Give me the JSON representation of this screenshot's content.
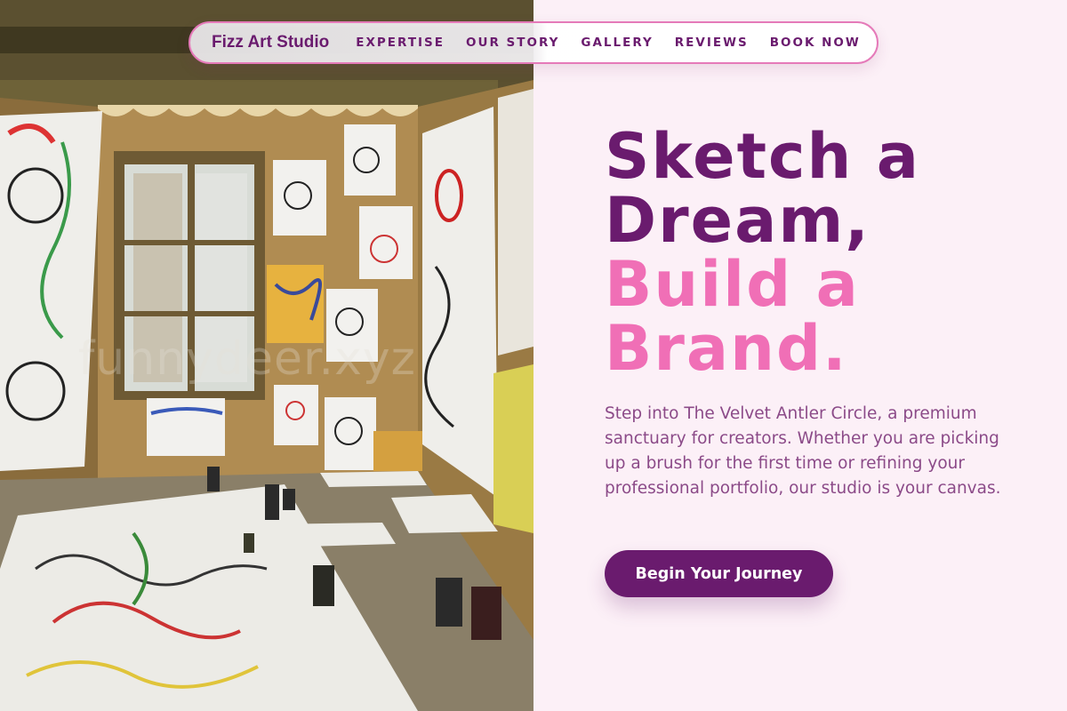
{
  "nav": {
    "brand": "Fizz Art Studio",
    "links": [
      "EXPERTISE",
      "OUR STORY",
      "GALLERY",
      "REVIEWS",
      "BOOK NOW"
    ]
  },
  "hero": {
    "title_line1": "Sketch a",
    "title_line2": "Dream,",
    "title_line3": "Build a",
    "title_line4": "Brand.",
    "description": "Step into The Velvet Antler Circle, a premium sanctuary for creators. Whether you are picking up a brush for the first time or refining your professional portfolio, our studio is your canvas.",
    "cta_label": "Begin Your Journey"
  },
  "image": {
    "watermark": "funnydeer.xyz",
    "description": "art studio room with doodle paintings on walls and floor"
  },
  "colors": {
    "primary": "#6a1b6e",
    "accent": "#f06fb6",
    "background": "#fcf0f7",
    "body_text": "#8b4a88"
  }
}
